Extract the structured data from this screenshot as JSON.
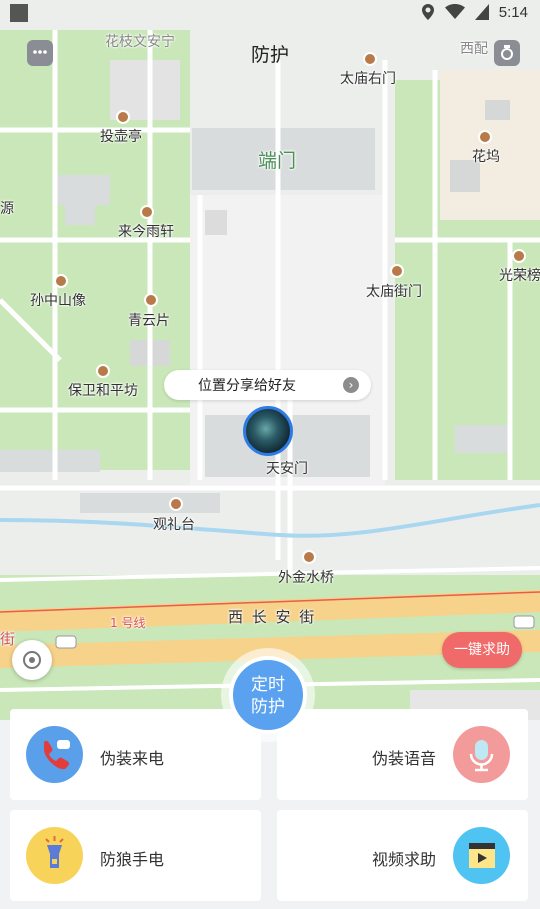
{
  "status_bar": {
    "time": "5:14"
  },
  "header": {
    "title": "防护",
    "left_icon": "chat-bubble-icon",
    "right_icon": "camera-icon"
  },
  "map": {
    "labels": {
      "top_left_partial": "花枝文安宁",
      "west_gate_partial": "西配",
      "taimiao_right": "太庙右门",
      "touhu": "投壶亭",
      "duanmen": "端门",
      "huawu": "花坞",
      "yuan": "源",
      "laijin": "来今雨轩",
      "guangrong": "光荣榜",
      "sunzhongshan": "孙中山像",
      "taimiao_gate": "太庙街门",
      "qingyun": "青云片",
      "baowei": "保卫和平坊",
      "tiananmen": "天安门",
      "guanli": "观礼台",
      "jinshui": "外金水桥",
      "changan": "西 长 安 街",
      "line1": "1 号线",
      "jie_partial": "街"
    },
    "share_pill": "位置分享给好友",
    "sos_button": "一键求助",
    "guard_button": [
      "定时",
      "防护"
    ]
  },
  "cards": [
    {
      "label": "伪装来电",
      "icon": "phone-call-icon",
      "color": "#5a9fea"
    },
    {
      "label": "伪装语音",
      "icon": "microphone-icon",
      "color": "#f39a9a"
    },
    {
      "label": "防狼手电",
      "icon": "flashlight-icon",
      "color": "#f8d35a"
    },
    {
      "label": "视频求助",
      "icon": "video-clapper-icon",
      "color": "#4fc3f2"
    }
  ]
}
